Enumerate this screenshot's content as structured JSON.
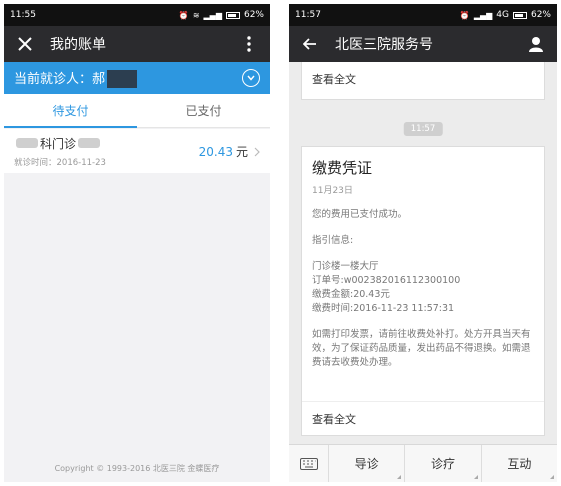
{
  "left": {
    "status": {
      "time": "11:55",
      "battery": "62%"
    },
    "header": {
      "title": "我的账单"
    },
    "patient": {
      "label": "当前就诊人：郝"
    },
    "tabs": [
      {
        "label": "待支付"
      },
      {
        "label": "已支付"
      }
    ],
    "bill": {
      "name_suffix": "科门诊",
      "date": "就诊时间：2016-11-23",
      "amount": "20.43",
      "unit": "元"
    },
    "footer": {
      "copyright": "Copyright © 1993-2016 北医三院 金蝶医疗"
    }
  },
  "right": {
    "status": {
      "time": "11:57",
      "network": "4G",
      "battery": "62%"
    },
    "header": {
      "title": "北医三院服务号"
    },
    "top_card": {
      "read_all": "查看全文"
    },
    "timestamp": "11:57",
    "card": {
      "title": "缴费凭证",
      "date": "11月23日",
      "success": "您的费用已支付成功。",
      "guide_label": "指引信息:",
      "location": "门诊楼一楼大厅",
      "order_no": "订单号:w002382016112300100",
      "amount": "缴费金额:20.43元",
      "time": "缴费时间:2016-11-23 11:57:31",
      "note": "如需打印发票，请前往收费处补打。处方开具当天有效，为了保证药品质量，发出药品不得退换。如需退费请去收费处办理。",
      "read_all": "查看全文"
    },
    "menu": [
      {
        "label": "导诊"
      },
      {
        "label": "诊疗"
      },
      {
        "label": "互动"
      }
    ]
  }
}
